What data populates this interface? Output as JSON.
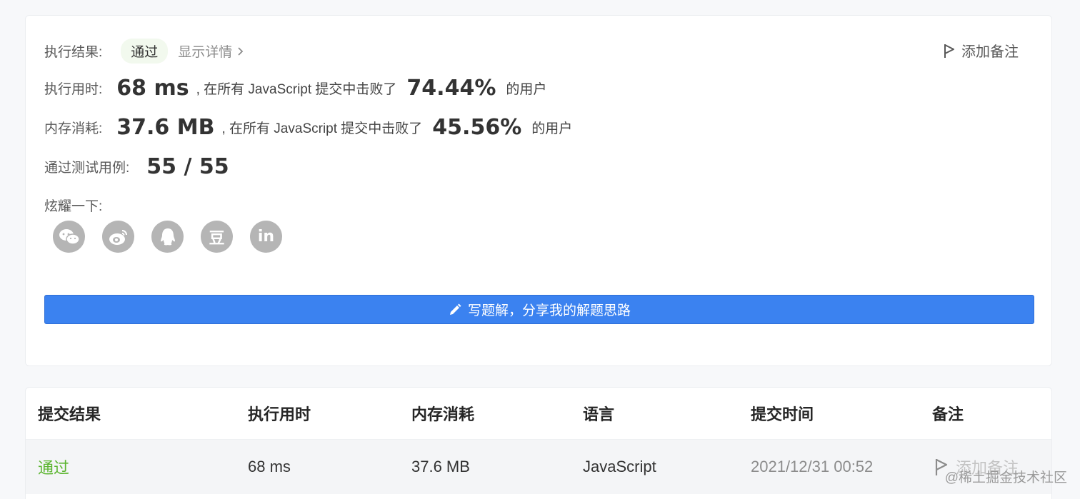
{
  "result": {
    "label": "执行结果:",
    "status": "通过",
    "detail_link": "显示详情",
    "add_note": "添加备注"
  },
  "runtime": {
    "label": "执行用时:",
    "value": "68 ms",
    "mid": ", 在所有 JavaScript 提交中击败了",
    "percent": "74.44%",
    "suffix": "的用户"
  },
  "memory": {
    "label": "内存消耗:",
    "value": "37.6 MB",
    "mid": ", 在所有 JavaScript 提交中击败了",
    "percent": "45.56%",
    "suffix": "的用户"
  },
  "testcases": {
    "label": "通过测试用例:",
    "value": "55 / 55"
  },
  "share": {
    "label": "炫耀一下:",
    "icons": [
      "wechat-icon",
      "weibo-icon",
      "qq-icon",
      "douban-icon",
      "linkedin-icon"
    ],
    "douban_glyph": "豆",
    "linkedin_glyph": "in"
  },
  "write_solution": {
    "label": "写题解，分享我的解题思路"
  },
  "table": {
    "headers": [
      "提交结果",
      "执行用时",
      "内存消耗",
      "语言",
      "提交时间",
      "备注"
    ],
    "rows": [
      {
        "status": "通过",
        "runtime": "68 ms",
        "memory": "37.6 MB",
        "language": "JavaScript",
        "time": "2021/12/31 00:52",
        "note": "添加备注"
      }
    ]
  },
  "watermark": "@稀土掘金技术社区",
  "colors": {
    "accent_blue": "#3b82f0",
    "pass_green": "#5cb531",
    "icon_gray": "#b5b5b5"
  }
}
